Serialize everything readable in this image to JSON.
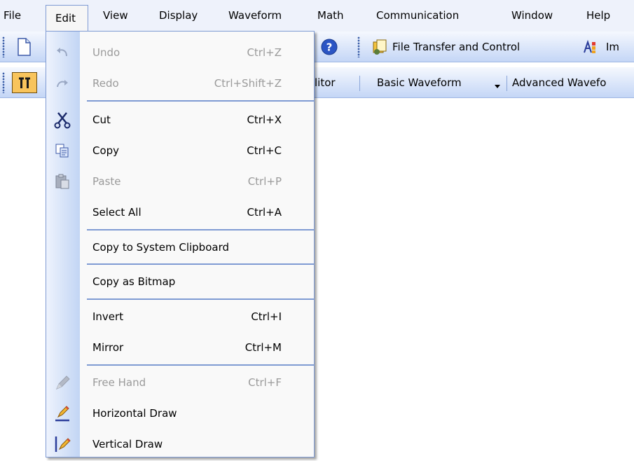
{
  "menubar": {
    "items": [
      {
        "label": "File"
      },
      {
        "label": "Edit"
      },
      {
        "label": "View"
      },
      {
        "label": "Display"
      },
      {
        "label": "Waveform"
      },
      {
        "label": "Math"
      },
      {
        "label": "Communication"
      },
      {
        "label": "Window"
      },
      {
        "label": "Help"
      }
    ]
  },
  "toolbar1": {
    "file_transfer_label": "File Transfer and Control",
    "truncated_label": "Im"
  },
  "toolbar2": {
    "editor_fragment": "litor",
    "basic_waveform_label": "Basic Waveform",
    "advanced_waveform_label": "Advanced Wavefo"
  },
  "edit_menu": {
    "items": [
      {
        "label": "Undo",
        "shortcut": "Ctrl+Z",
        "icon": "undo-icon",
        "enabled": false
      },
      {
        "label": "Redo",
        "shortcut": "Ctrl+Shift+Z",
        "icon": "redo-icon",
        "enabled": false
      },
      {
        "label": "Cut",
        "shortcut": "Ctrl+X",
        "icon": "scissors-icon",
        "enabled": true
      },
      {
        "label": "Copy",
        "shortcut": "Ctrl+C",
        "icon": "copy-icon",
        "enabled": true
      },
      {
        "label": "Paste",
        "shortcut": "Ctrl+P",
        "icon": "paste-icon",
        "enabled": false
      },
      {
        "label": "Select All",
        "shortcut": "Ctrl+A",
        "enabled": true
      },
      {
        "label": "Copy to System Clipboard",
        "enabled": true
      },
      {
        "label": "Copy as Bitmap",
        "enabled": true
      },
      {
        "label": "Invert",
        "shortcut": "Ctrl+I",
        "enabled": true
      },
      {
        "label": "Mirror",
        "shortcut": "Ctrl+M",
        "enabled": true
      },
      {
        "label": "Free Hand",
        "shortcut": "Ctrl+F",
        "icon": "pencil-icon",
        "enabled": false
      },
      {
        "label": "Horizontal Draw",
        "icon": "horizontal-draw-icon",
        "enabled": true
      },
      {
        "label": "Vertical Draw",
        "icon": "vertical-draw-icon",
        "enabled": true
      }
    ]
  },
  "colors": {
    "menubar_bg": "#eef2fb",
    "menu_border": "#7f9bd3",
    "disabled_text": "#9a9a9a",
    "help_icon_blue": "#2b55c4"
  }
}
